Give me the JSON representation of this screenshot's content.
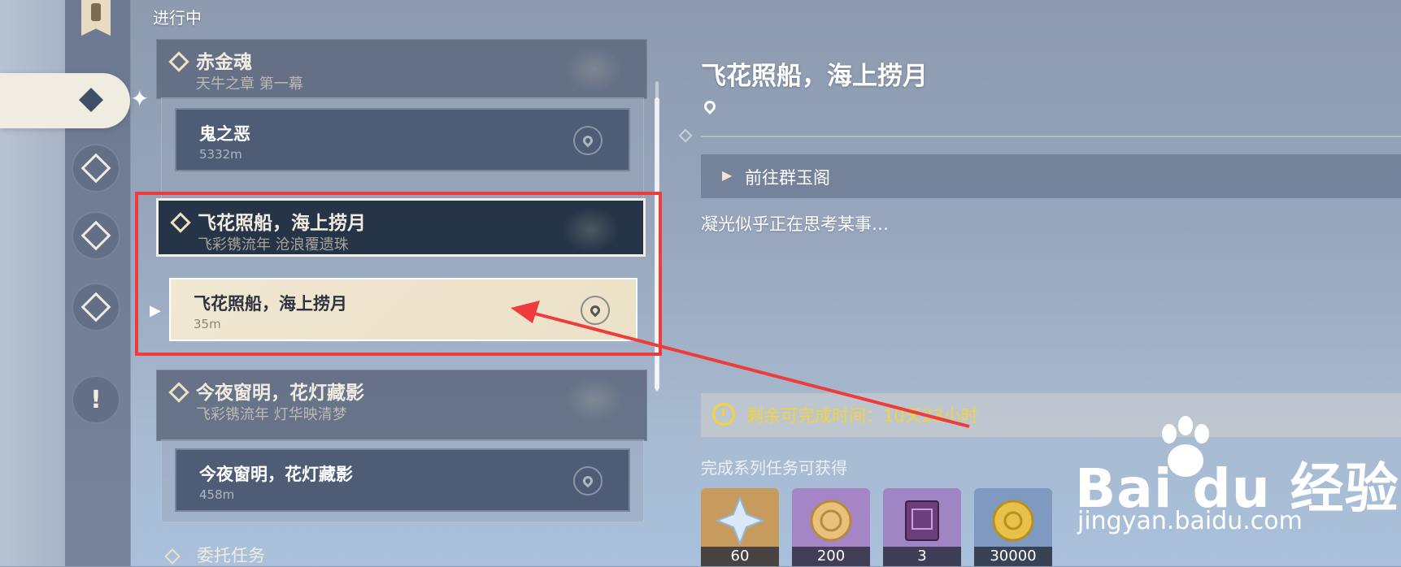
{
  "section_title": "进行中",
  "quests": [
    {
      "title": "赤金魂",
      "chapter": "天牛之章 第一幕",
      "sub_title": "鬼之恶",
      "sub_distance": "5332m"
    },
    {
      "title": "飞花照船，海上捞月",
      "chapter": "飞彩镌流年 沧浪覆遗珠",
      "sub_title": "飞花照船，海上捞月",
      "sub_distance": "35m"
    },
    {
      "title": "今夜窗明，花灯藏影",
      "chapter": "飞彩镌流年 灯华映清梦",
      "sub_title": "今夜窗明，花灯藏影",
      "sub_distance": "458m"
    }
  ],
  "commission_label": "委托任务",
  "detail": {
    "title": "飞花照船，海上捞月",
    "step": "前往群玉阁",
    "description": "凝光似乎正在思考某事…",
    "timer": "剩余可完成时间：10天23小时",
    "rewards_title": "完成系列任务可获得",
    "rewards": [
      {
        "icon": "primogem-icon",
        "count": "60",
        "bg": "#c79a5e"
      },
      {
        "icon": "hero-wit-icon",
        "count": "200",
        "bg": "#a585c5"
      },
      {
        "icon": "book-icon",
        "count": "3",
        "bg": "#a085c5"
      },
      {
        "icon": "mora-icon",
        "count": "30000",
        "bg": "#7e9ac0"
      }
    ]
  },
  "watermark": {
    "logo": "Bai du 经验",
    "url": "jingyan.baidu.com"
  },
  "colors": {
    "highlight": "#ee3b3b",
    "timer_text": "#f2d33d",
    "active_header": "#263447",
    "active_card": "#f1e8d3"
  }
}
